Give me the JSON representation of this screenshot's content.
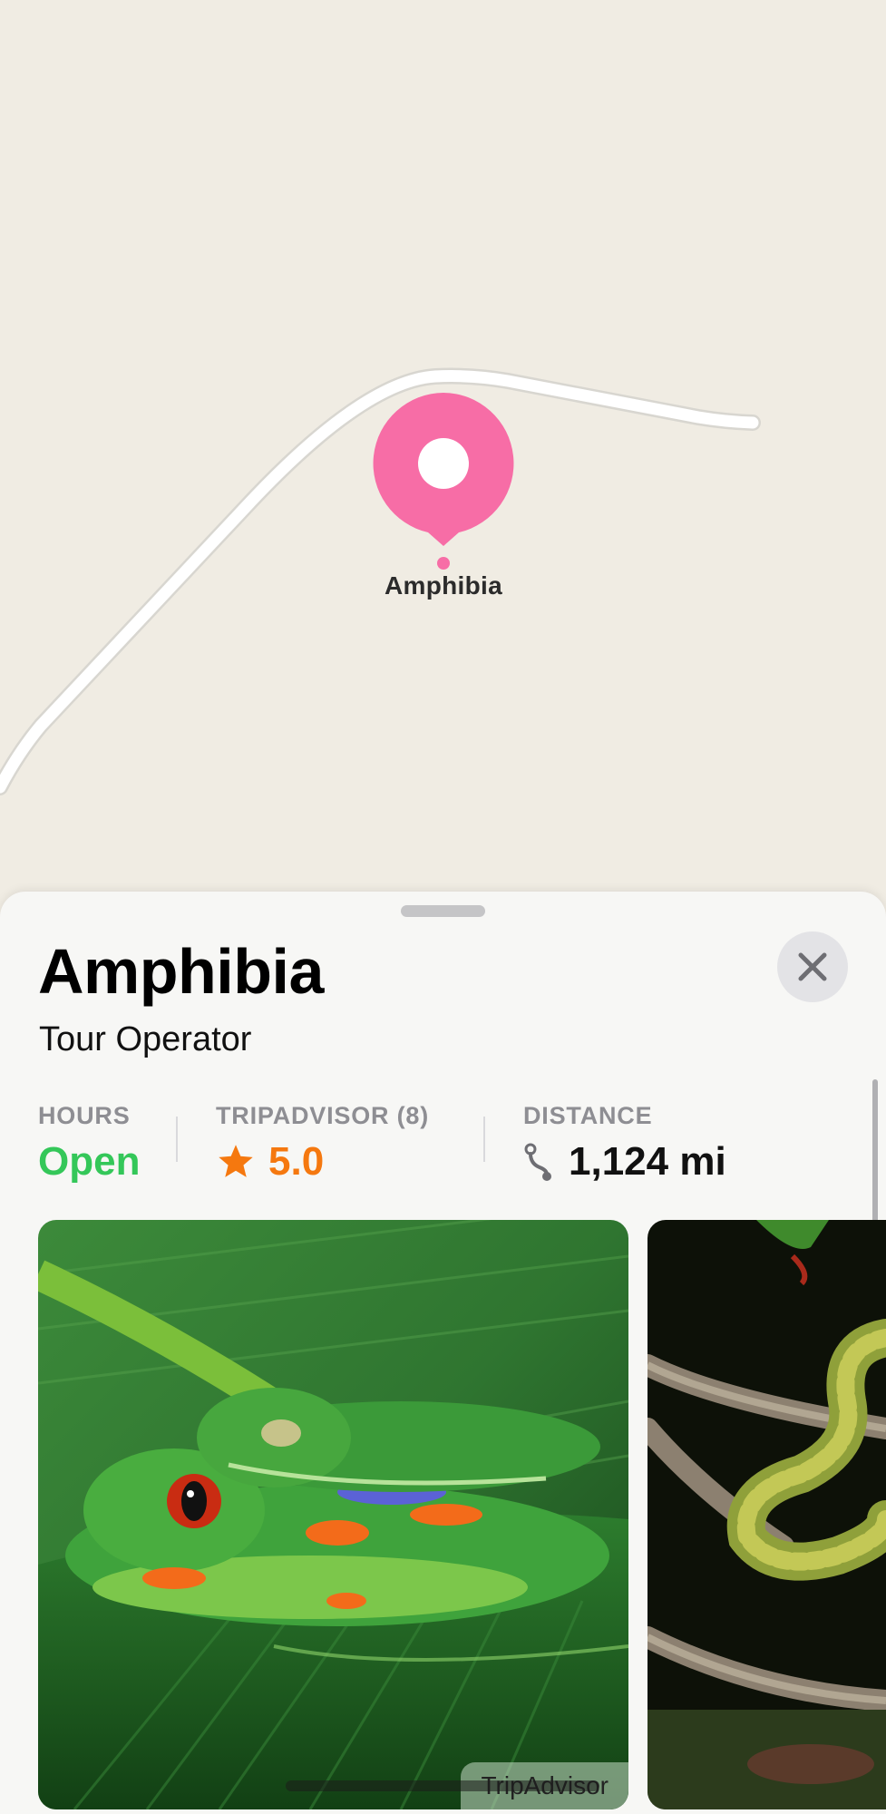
{
  "map": {
    "pin_label": "Amphibia",
    "pin_color": "#f76da6"
  },
  "place": {
    "title": "Amphibia",
    "category": "Tour Operator"
  },
  "stats": {
    "hours_label": "HOURS",
    "hours_value": "Open",
    "rating_label": "TRIPADVISOR (8)",
    "rating_value": "5.0",
    "distance_label": "DISTANCE",
    "distance_value": "1,124 mi"
  },
  "photos": {
    "attribution": "TripAdvisor"
  },
  "colors": {
    "open": "#34c759",
    "rating": "#f5780f",
    "label_gray": "#8e8e93"
  },
  "icons": {
    "close": "close-icon",
    "star": "star-icon",
    "distance": "route-icon"
  }
}
